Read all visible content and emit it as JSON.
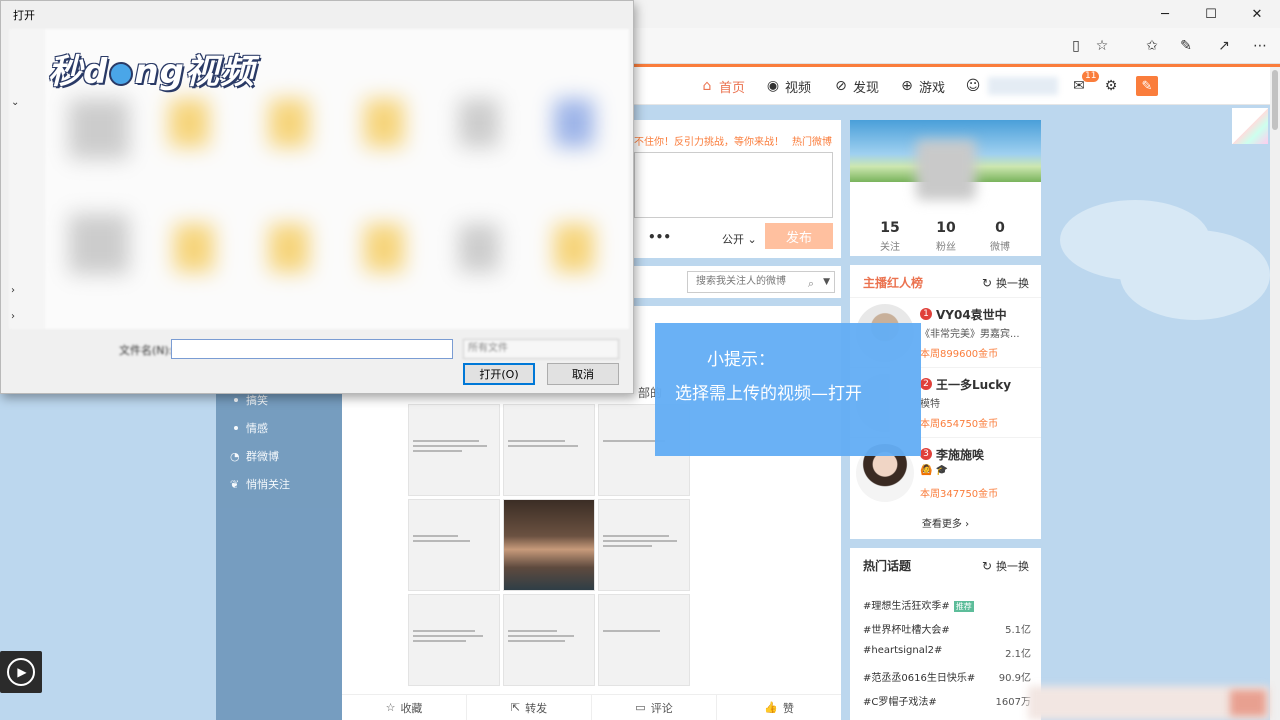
{
  "dialog": {
    "title": "打开",
    "filename_label": "文件名(N):",
    "filetype_value": "所有文件",
    "open_button": "打开(O)",
    "cancel_button": "取消"
  },
  "logo": {
    "text_left": "秒d",
    "text_right": "ng视频"
  },
  "browser": {
    "minimize": "─",
    "maximize": "☐",
    "close": "✕"
  },
  "nav": {
    "home": "首页",
    "video": "视频",
    "discover": "发现",
    "game": "游戏",
    "mail_badge": "11"
  },
  "publish": {
    "hint": "不住你！反引力挑战，等你来战！",
    "hot": "热门微博",
    "more": "•••",
    "visibility": "公开",
    "submit": "发布"
  },
  "feed": {
    "search_placeholder": "搜索我关注人的微博",
    "title_text": "部的",
    "actions": [
      {
        "label": "收藏"
      },
      {
        "label": "转发"
      },
      {
        "label": "评论"
      },
      {
        "label": "赞"
      }
    ]
  },
  "left_nav": {
    "items": [
      {
        "label": "搞笑"
      },
      {
        "label": "情感"
      },
      {
        "label": "群微博"
      },
      {
        "label": "悄悄关注"
      }
    ]
  },
  "profile": {
    "stats": [
      {
        "num": "15",
        "label": "关注"
      },
      {
        "num": "10",
        "label": "粉丝"
      },
      {
        "num": "0",
        "label": "微博"
      }
    ]
  },
  "rank": {
    "title": "主播红人榜",
    "refresh": "换一换",
    "items": [
      {
        "num": "1",
        "name": "VY04袁世中",
        "sub": "《非常完美》男嘉宾...",
        "coin": "本周899600金币"
      },
      {
        "num": "2",
        "name": "王一多Lucky",
        "sub": "模特",
        "coin": "本周654750金币"
      },
      {
        "num": "3",
        "name": "李施施唉",
        "sub": "🙆 🎓",
        "coin": "本周347750金币"
      }
    ],
    "see_more": "查看更多 ›"
  },
  "topics": {
    "title": "热门话题",
    "refresh": "换一换",
    "rec_tag": "推荐",
    "items": [
      {
        "name": "#理想生活狂欢季#",
        "count": ""
      },
      {
        "name": "#世界杯吐槽大会#",
        "count": "5.1亿"
      },
      {
        "name": "#heartsignal2#",
        "count": "2.1亿"
      },
      {
        "name": "#范丞丞0616生日快乐#",
        "count": "90.9亿"
      },
      {
        "name": "#C罗帽子戏法#",
        "count": "1607万"
      }
    ]
  },
  "tip": {
    "title": "小提示：",
    "body": "选择需上传的视频—打开"
  }
}
